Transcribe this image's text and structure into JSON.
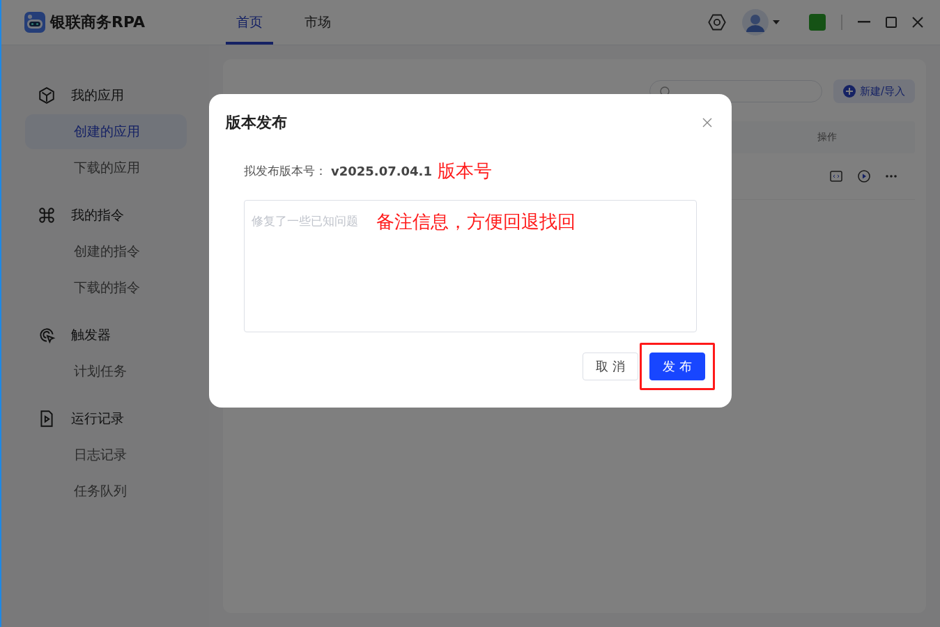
{
  "app": {
    "title": "银联商务RPA"
  },
  "nav_tabs": [
    {
      "label": "首页",
      "selected": true
    },
    {
      "label": "市场",
      "selected": false
    }
  ],
  "sidebar": [
    {
      "label": "我的应用",
      "kind": "cube",
      "children": [
        {
          "label": "创建的应用",
          "selected": true
        },
        {
          "label": "下载的应用",
          "selected": false
        }
      ]
    },
    {
      "label": "我的指令",
      "kind": "command",
      "children": [
        {
          "label": "创建的指令",
          "selected": false
        },
        {
          "label": "下载的指令",
          "selected": false
        }
      ]
    },
    {
      "label": "触发器",
      "kind": "trigger",
      "children": [
        {
          "label": "计划任务",
          "selected": false
        }
      ]
    },
    {
      "label": "运行记录",
      "kind": "record",
      "children": [
        {
          "label": "日志记录",
          "selected": false
        },
        {
          "label": "任务队列",
          "selected": false
        }
      ]
    }
  ],
  "content": {
    "new_button": "新建/导入",
    "table_header": "操作"
  },
  "dialog": {
    "title": "版本发布",
    "version_label": "拟发布版本号：",
    "version": "v2025.07.04.1",
    "version_note": "版本号",
    "notes_placeholder": "修复了一些已知问题",
    "notes_note": "备注信息，方便回退找回",
    "buttons": [
      {
        "label": "取 消",
        "kind": "secondary",
        "highlighted": false
      },
      {
        "label": "发 布",
        "kind": "primary",
        "highlighted": true
      }
    ]
  }
}
